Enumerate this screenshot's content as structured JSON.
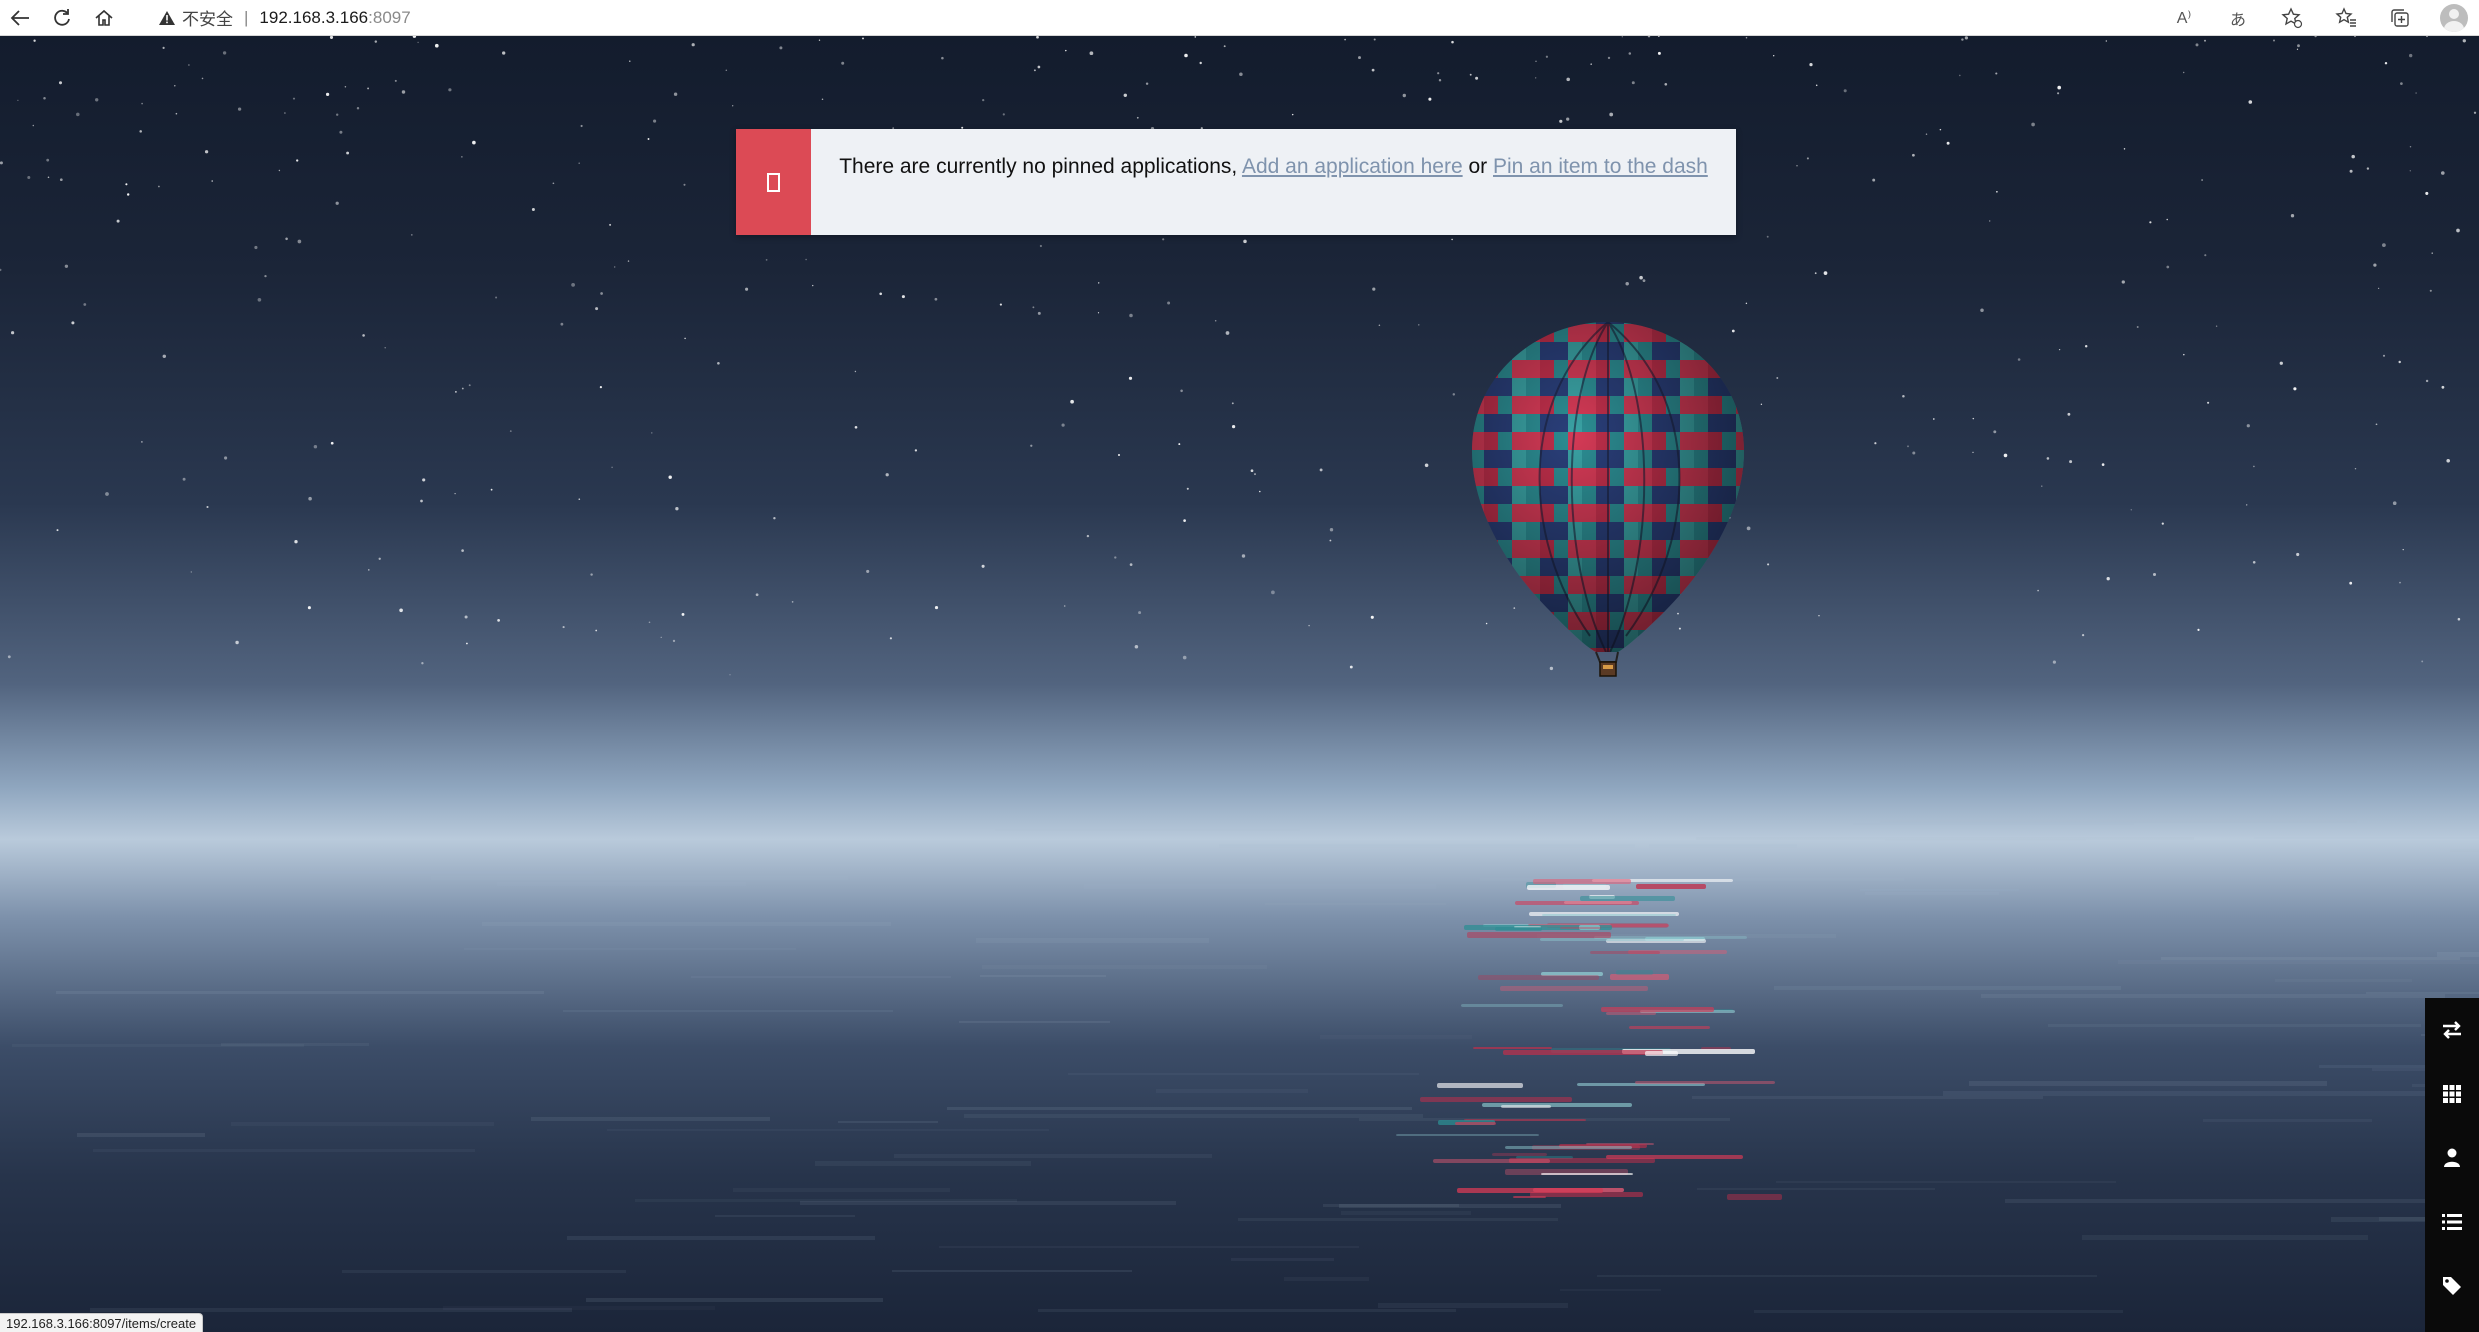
{
  "browser": {
    "security_label": "不安全",
    "separator": "|",
    "url_host": "192.168.3.166",
    "url_port": ":8097",
    "tools": {
      "read_aloud": "A⁾",
      "translate": "あ"
    }
  },
  "alert": {
    "text_before": "There are currently no pinned applications,",
    "link_add_app": "Add an application here",
    "text_or": "or",
    "link_pin_item": "Pin an item to the dash"
  },
  "sidebar": {
    "items": [
      {
        "icon": "arrows-exchange-icon"
      },
      {
        "icon": "grid-icon"
      },
      {
        "icon": "user-icon"
      },
      {
        "icon": "list-icon"
      },
      {
        "icon": "tag-icon"
      },
      {
        "icon": "cogs-icon"
      }
    ]
  },
  "status_bar": {
    "text": "192.168.3.166:8097/items/create"
  },
  "colors": {
    "alert_accent": "#dc4a55",
    "alert_background": "#eef1f5",
    "link_color": "#7f93ad",
    "sidebar_background": "#0a0a0a"
  }
}
